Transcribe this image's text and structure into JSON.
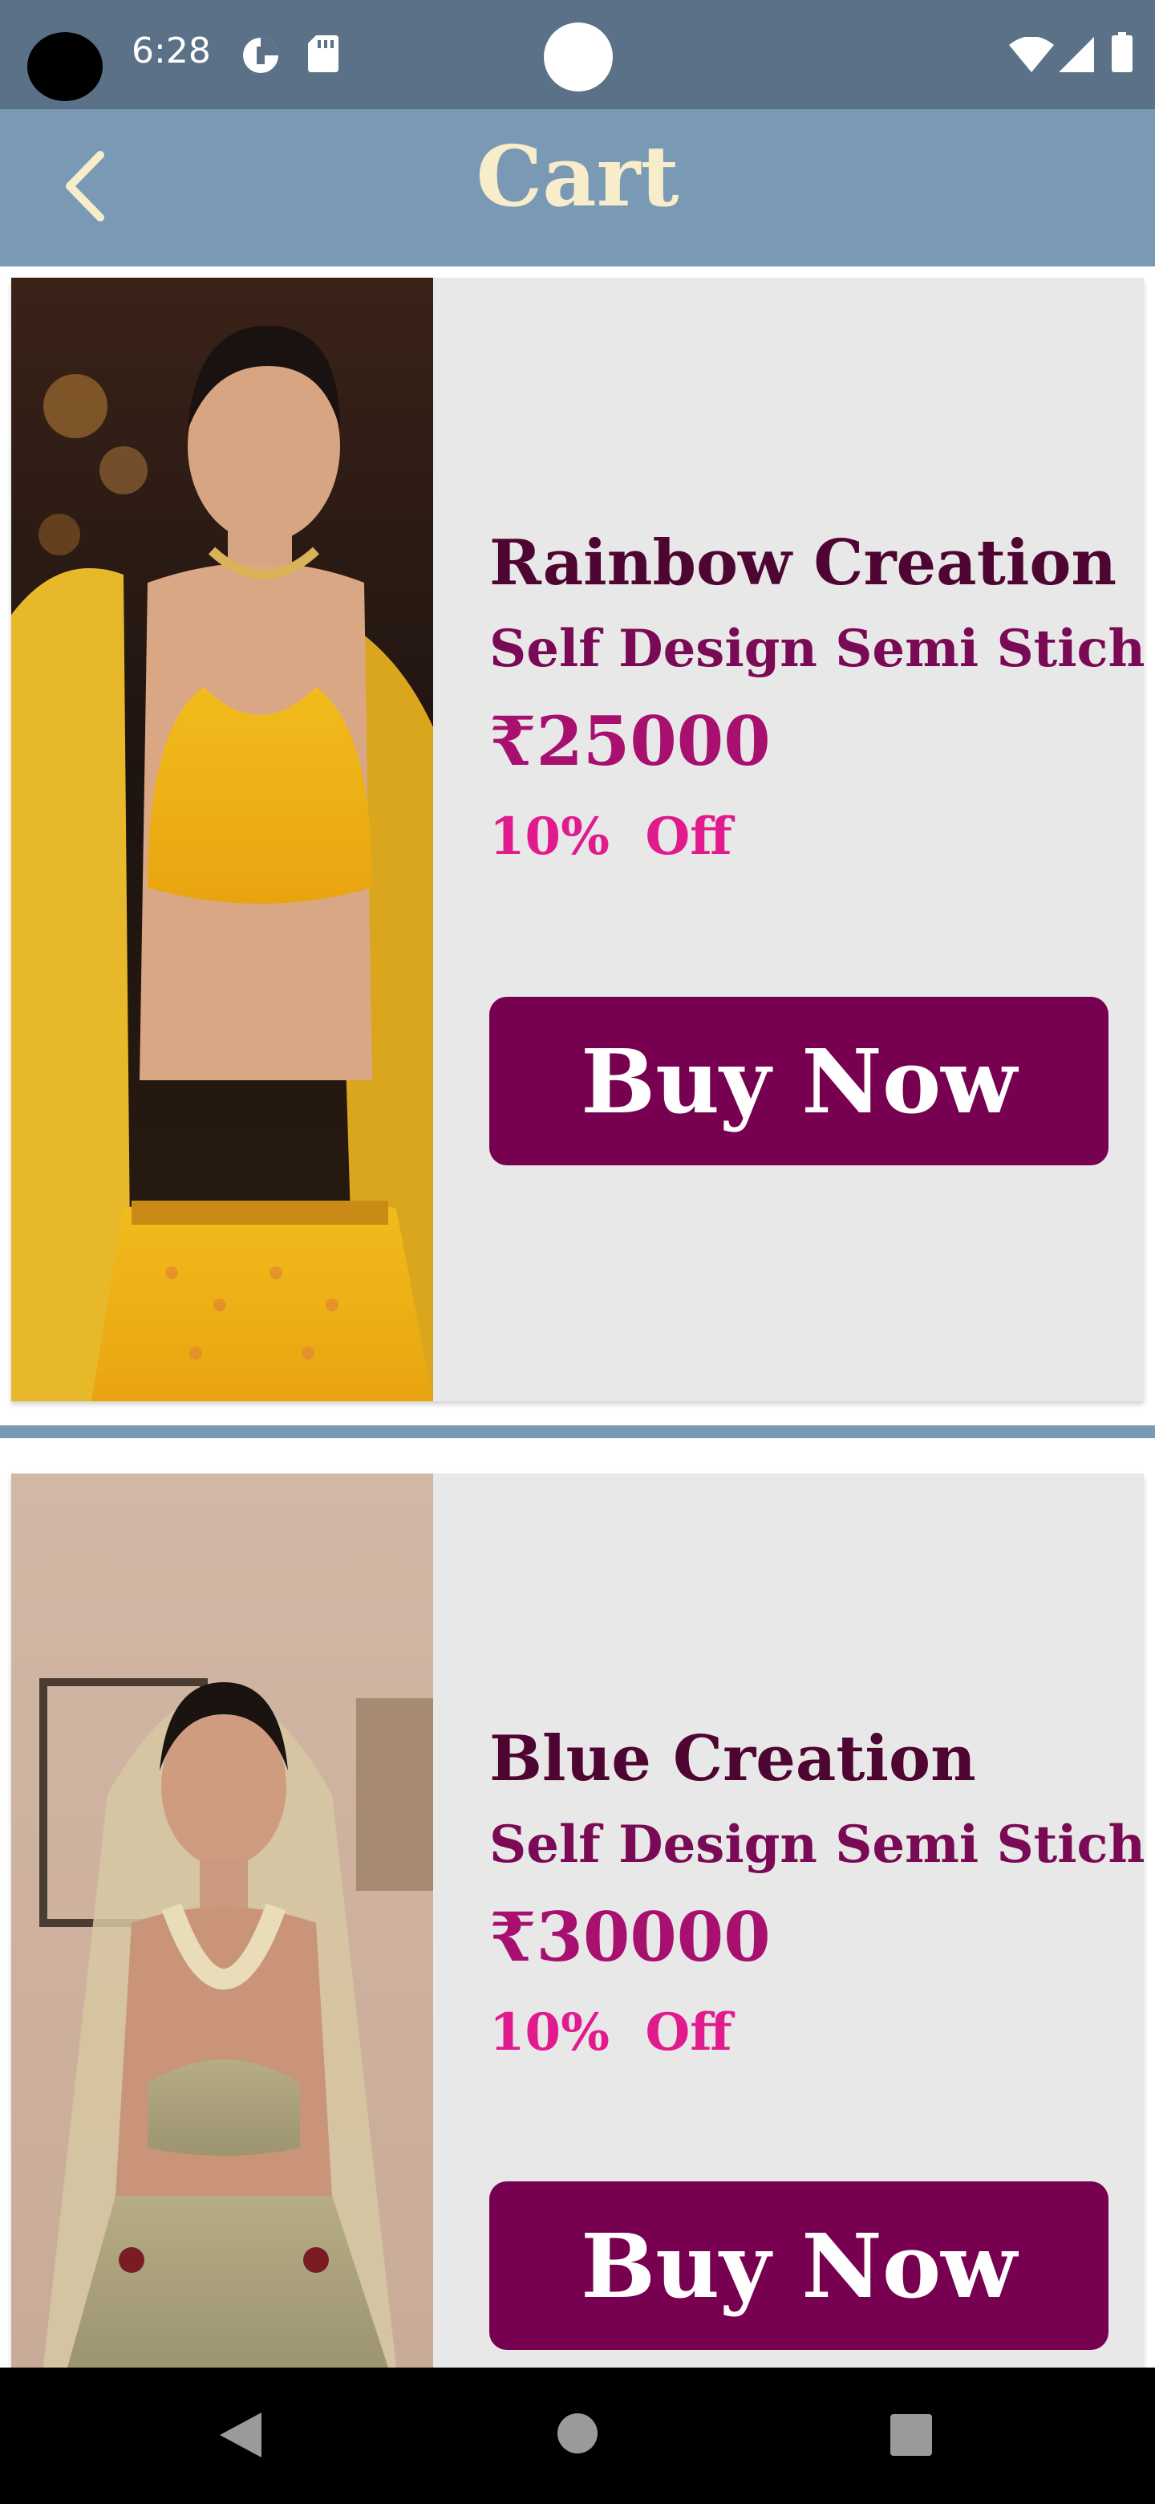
{
  "status_bar": {
    "time": "6:28"
  },
  "header": {
    "title": "Cart",
    "back_icon": "chevron-left-icon"
  },
  "cart_items": [
    {
      "name": "Rainbow Creation",
      "description": "Self Design Semi Stich",
      "price": "₹25000",
      "discount": "10%  Off",
      "button_label": "Buy Now"
    },
    {
      "name": "Blue Creation",
      "description": "Self Design Semi Stich",
      "price": "₹30000",
      "discount": "10%  Off",
      "button_label": "Buy Now"
    }
  ],
  "colors": {
    "app_bar": "#7a99b4",
    "title": "#f7edca",
    "button": "#780050",
    "price": "#a7106f",
    "discount": "#e11b8e"
  }
}
